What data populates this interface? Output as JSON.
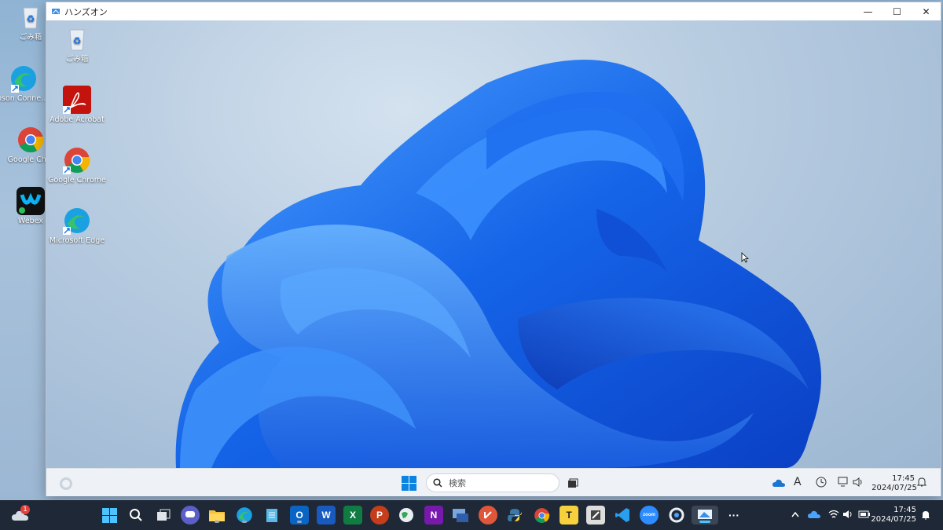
{
  "outer_desktop": {
    "icons": [
      {
        "label": "ごみ箱",
        "icon": "recycle-bin-icon"
      },
      {
        "label": "Epson Conne…ィト",
        "icon": "edge-icon"
      },
      {
        "label": "Google Chro",
        "icon": "chrome-icon"
      },
      {
        "label": "Webex",
        "icon": "webex-icon"
      }
    ]
  },
  "window": {
    "title": "ハンズオン",
    "controls": {
      "minimize": "—",
      "maximize": "☐",
      "close": "✕"
    }
  },
  "inner_desktop": {
    "icons": [
      {
        "label": "ごみ箱",
        "icon": "recycle-bin-icon"
      },
      {
        "label": "Adobe Acrobat",
        "icon": "acrobat-icon"
      },
      {
        "label": "Google Chrome",
        "icon": "chrome-icon"
      },
      {
        "label": "Microsoft Edge",
        "icon": "edge-icon"
      }
    ],
    "taskbar": {
      "search_placeholder": "検索",
      "time": "17:45",
      "date": "2024/07/25",
      "ime_indicator": "A"
    }
  },
  "taskbar": {
    "notification_badge": "1",
    "apps": [
      {
        "name": "start",
        "label": ""
      },
      {
        "name": "search",
        "label": ""
      },
      {
        "name": "task-view",
        "label": ""
      },
      {
        "name": "teams-chat",
        "label": ""
      },
      {
        "name": "file-explorer",
        "label": ""
      },
      {
        "name": "edge",
        "label": ""
      },
      {
        "name": "notepad",
        "label": ""
      },
      {
        "name": "outlook",
        "label": "O"
      },
      {
        "name": "word",
        "label": "W"
      },
      {
        "name": "excel",
        "label": "X"
      },
      {
        "name": "powerpoint",
        "label": "P"
      },
      {
        "name": "earth",
        "label": ""
      },
      {
        "name": "onenote",
        "label": "N"
      },
      {
        "name": "remote-app",
        "label": ""
      },
      {
        "name": "git",
        "label": ""
      },
      {
        "name": "python",
        "label": ""
      },
      {
        "name": "chrome",
        "label": ""
      },
      {
        "name": "typora",
        "label": "T"
      },
      {
        "name": "tool",
        "label": ""
      },
      {
        "name": "vscode",
        "label": ""
      },
      {
        "name": "zoom",
        "label": "zoom"
      },
      {
        "name": "app-c",
        "label": ""
      },
      {
        "name": "remote-desktop",
        "label": ""
      },
      {
        "name": "more",
        "label": "···"
      }
    ],
    "time": "17:45",
    "date": "2024/07/25"
  },
  "colors": {
    "taskbar": "#1f2836",
    "bloom": "#1e6df0",
    "accent": "#0078d4"
  }
}
